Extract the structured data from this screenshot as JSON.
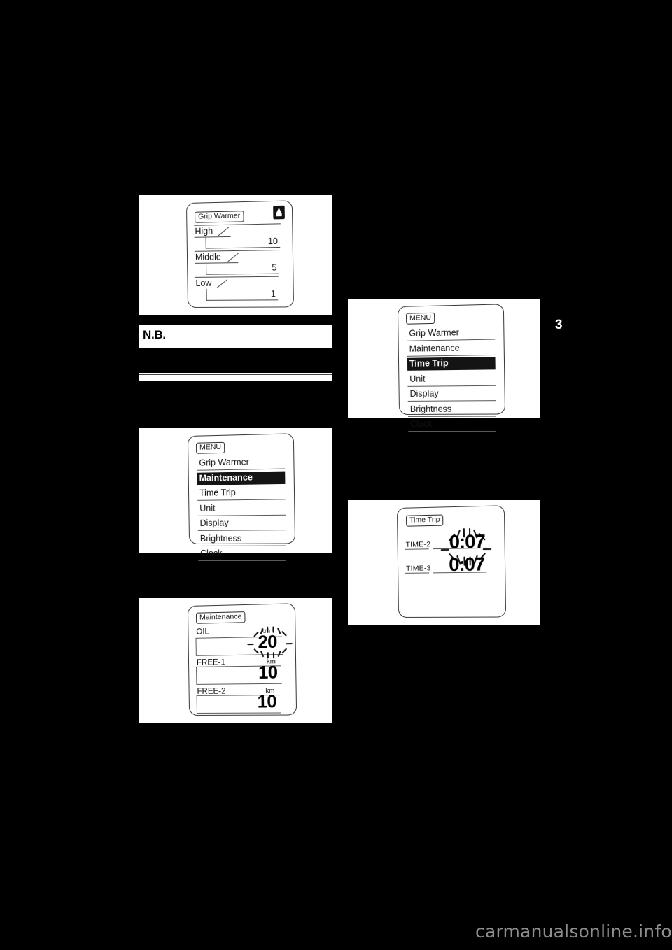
{
  "page": {
    "background_color": "#000000",
    "content_color": "#ffffff",
    "chapter_tab": "3",
    "watermark": "carmanualsonline.info"
  },
  "figures": {
    "grip_warmer": {
      "title_tag": "Grip Warmer",
      "icon": "grip-warmer-heat-icon",
      "levels": [
        {
          "label": "High",
          "value": "10"
        },
        {
          "label": "Middle",
          "value": "5"
        },
        {
          "label": "Low",
          "value": "1"
        }
      ]
    },
    "menu_maintenance": {
      "title_tag": "MENU",
      "items": [
        {
          "label": "Grip Warmer",
          "selected": false
        },
        {
          "label": "Maintenance",
          "selected": true
        },
        {
          "label": "Time Trip",
          "selected": false
        },
        {
          "label": "Unit",
          "selected": false
        },
        {
          "label": "Display",
          "selected": false
        },
        {
          "label": "Brightness",
          "selected": false
        },
        {
          "label": "Clock",
          "selected": false
        }
      ]
    },
    "menu_time_trip": {
      "title_tag": "MENU",
      "items": [
        {
          "label": "Grip Warmer",
          "selected": false
        },
        {
          "label": "Maintenance",
          "selected": false
        },
        {
          "label": "Time Trip",
          "selected": true
        },
        {
          "label": "Unit",
          "selected": false
        },
        {
          "label": "Display",
          "selected": false
        },
        {
          "label": "Brightness",
          "selected": false
        },
        {
          "label": "Clock",
          "selected": false
        }
      ]
    },
    "maintenance": {
      "title_tag": "Maintenance",
      "rows": [
        {
          "label": "OIL",
          "unit": "km",
          "value": "20",
          "flashing": true
        },
        {
          "label": "FREE-1",
          "unit": "km",
          "value": "10",
          "flashing": false
        },
        {
          "label": "FREE-2",
          "unit": "km",
          "value": "10",
          "flashing": false
        }
      ]
    },
    "time_trip": {
      "title_tag": "Time Trip",
      "rows": [
        {
          "label": "TIME-2",
          "value": "0:07",
          "flashing": true
        },
        {
          "label": "TIME-3",
          "value": "0:07",
          "flashing": false
        }
      ]
    }
  },
  "note": {
    "heading": "N.B.",
    "body": ""
  }
}
